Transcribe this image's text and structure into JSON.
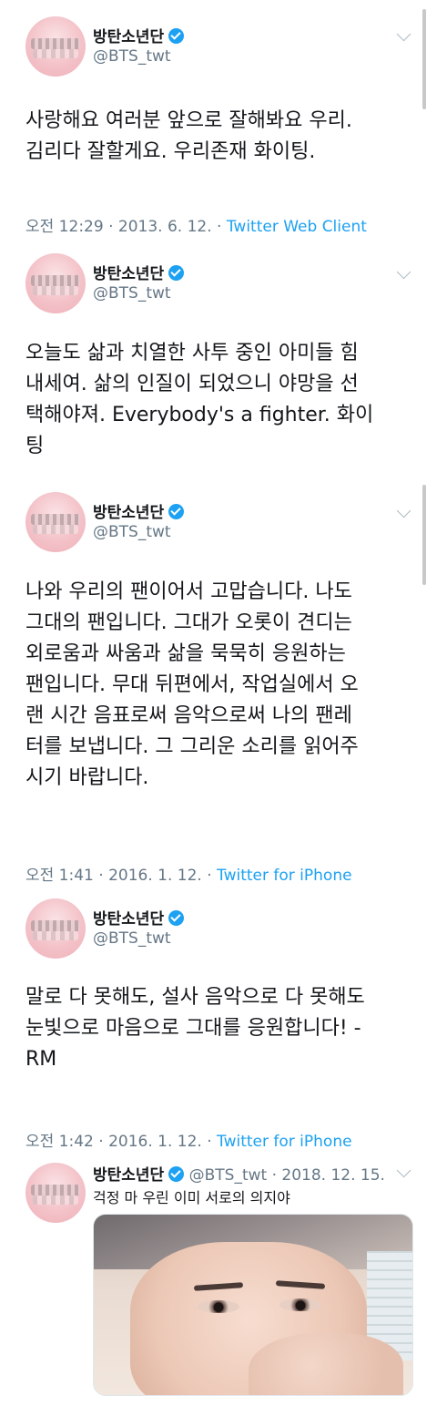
{
  "tweets": [
    {
      "name": "방탄소년단",
      "handle": "@BTS_twt",
      "text_lines": [
        "사랑해요 여러분 앞으로 잘해봐요 우리.",
        "김리다 잘할게요. 우리존재 화이팅."
      ],
      "time": "오전 12:29 · 2013. 6. 12. · ",
      "source": "Twitter Web Client"
    },
    {
      "name": "방탄소년단",
      "handle": "@BTS_twt",
      "text_lines": [
        "오늘도 삶과 치열한 사투 중인 아미들 힘",
        "내세여. 삶의 인질이 되었으니 야망을 선",
        "택해야져. Everybody's a fighter. 화이",
        "팅"
      ]
    },
    {
      "name": "방탄소년단",
      "handle": "@BTS_twt",
      "text_lines": [
        "나와 우리의 팬이어서 고맙습니다. 나도",
        "그대의 팬입니다. 그대가 오롯이 견디는",
        "외로움과 싸움과 삶을 묵묵히 응원하는",
        "팬입니다. 무대 뒤편에서, 작업실에서 오",
        "랜 시간 음표로써 음악으로써 나의 팬레",
        "터를 보냅니다. 그 그리운 소리를 읽어주",
        "시기 바랍니다."
      ],
      "time": "오전 1:41 · 2016. 1. 12. · ",
      "source": "Twitter for iPhone"
    },
    {
      "name": "방탄소년단",
      "handle": "@BTS_twt",
      "text_lines": [
        "말로 다 못해도, 설사 음악으로 다 못해도",
        "눈빛으로 마음으로 그대를 응원합니다! -",
        "RM"
      ],
      "time": "오전 1:42 · 2016. 1. 12. · ",
      "source": "Twitter for iPhone"
    },
    {
      "name": "방탄소년단",
      "handle": "@BTS_twt",
      "date": " · 2018. 12. 15.",
      "text": "걱정 마 우린 이미 서로의 의지야"
    }
  ],
  "colors": {
    "link": "#1da1f2",
    "muted": "#657786",
    "text": "#14171a"
  },
  "icons": {
    "verified": "verified-badge-icon",
    "menu": "chevron-down-icon"
  }
}
